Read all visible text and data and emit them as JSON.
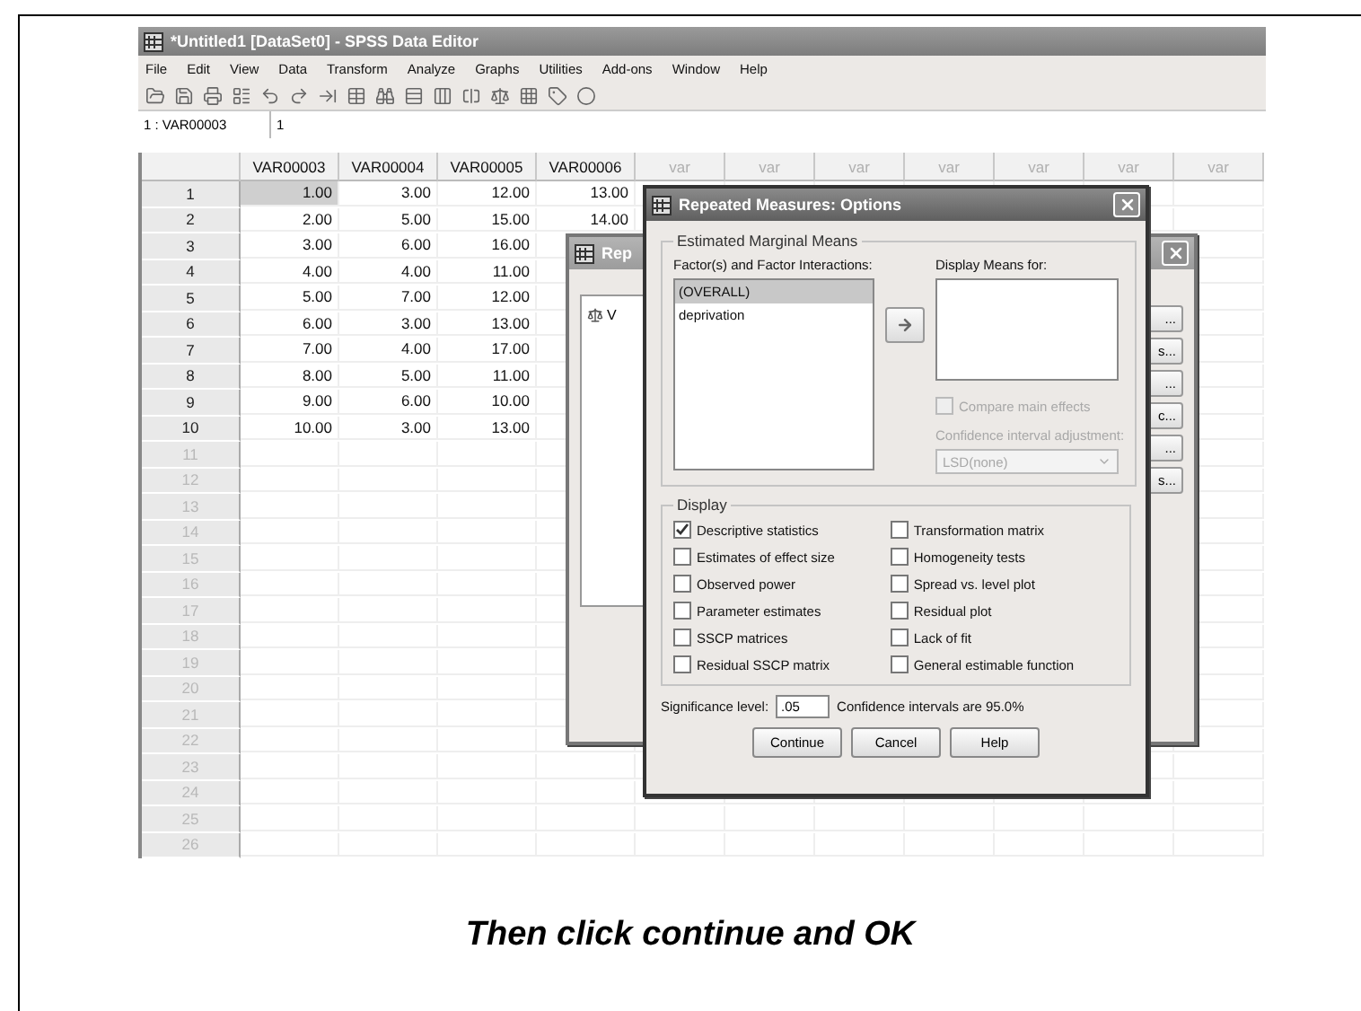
{
  "window": {
    "title": "*Untitled1 [DataSet0] - SPSS Data Editor"
  },
  "menu": [
    "File",
    "Edit",
    "View",
    "Data",
    "Transform",
    "Analyze",
    "Graphs",
    "Utilities",
    "Add-ons",
    "Window",
    "Help"
  ],
  "cell_editor": {
    "reference": "1 : VAR00003",
    "value": "1"
  },
  "table": {
    "columns": [
      {
        "label": "VAR00003",
        "kind": "variable"
      },
      {
        "label": "VAR00004",
        "kind": "variable"
      },
      {
        "label": "VAR00005",
        "kind": "variable"
      },
      {
        "label": "VAR00006",
        "kind": "variable"
      },
      {
        "label": "var",
        "kind": "empty"
      },
      {
        "label": "var",
        "kind": "empty"
      },
      {
        "label": "var",
        "kind": "empty"
      },
      {
        "label": "var",
        "kind": "empty"
      },
      {
        "label": "var",
        "kind": "empty"
      },
      {
        "label": "var",
        "kind": "empty"
      },
      {
        "label": "var",
        "kind": "empty"
      }
    ],
    "rows": [
      {
        "label": "1",
        "has_data": true,
        "cells": [
          {
            "text": "1.00",
            "selected": true
          },
          {
            "text": "3.00",
            "selected": false
          },
          {
            "text": "12.00",
            "selected": false
          },
          {
            "text": "13.00",
            "selected": false
          }
        ]
      },
      {
        "label": "2",
        "has_data": true,
        "cells": [
          {
            "text": "2.00",
            "selected": false
          },
          {
            "text": "5.00",
            "selected": false
          },
          {
            "text": "15.00",
            "selected": false
          },
          {
            "text": "14.00",
            "selected": false
          }
        ]
      },
      {
        "label": "3",
        "has_data": true,
        "cells": [
          {
            "text": "3.00",
            "selected": false
          },
          {
            "text": "6.00",
            "selected": false
          },
          {
            "text": "16.00",
            "selected": false
          }
        ]
      },
      {
        "label": "4",
        "has_data": true,
        "cells": [
          {
            "text": "4.00",
            "selected": false
          },
          {
            "text": "4.00",
            "selected": false
          },
          {
            "text": "11.00",
            "selected": false
          }
        ]
      },
      {
        "label": "5",
        "has_data": true,
        "cells": [
          {
            "text": "5.00",
            "selected": false
          },
          {
            "text": "7.00",
            "selected": false
          },
          {
            "text": "12.00",
            "selected": false
          }
        ]
      },
      {
        "label": "6",
        "has_data": true,
        "cells": [
          {
            "text": "6.00",
            "selected": false
          },
          {
            "text": "3.00",
            "selected": false
          },
          {
            "text": "13.00",
            "selected": false
          }
        ]
      },
      {
        "label": "7",
        "has_data": true,
        "cells": [
          {
            "text": "7.00",
            "selected": false
          },
          {
            "text": "4.00",
            "selected": false
          },
          {
            "text": "17.00",
            "selected": false
          }
        ]
      },
      {
        "label": "8",
        "has_data": true,
        "cells": [
          {
            "text": "8.00",
            "selected": false
          },
          {
            "text": "5.00",
            "selected": false
          },
          {
            "text": "11.00",
            "selected": false
          }
        ]
      },
      {
        "label": "9",
        "has_data": true,
        "cells": [
          {
            "text": "9.00",
            "selected": false
          },
          {
            "text": "6.00",
            "selected": false
          },
          {
            "text": "10.00",
            "selected": false
          }
        ]
      },
      {
        "label": "10",
        "has_data": true,
        "cells": [
          {
            "text": "10.00",
            "selected": false
          },
          {
            "text": "3.00",
            "selected": false
          },
          {
            "text": "13.00",
            "selected": false
          }
        ]
      },
      {
        "label": "11",
        "has_data": false
      },
      {
        "label": "12",
        "has_data": false
      },
      {
        "label": "13",
        "has_data": false
      },
      {
        "label": "14",
        "has_data": false
      },
      {
        "label": "15",
        "has_data": false
      },
      {
        "label": "16",
        "has_data": false
      },
      {
        "label": "17",
        "has_data": false
      },
      {
        "label": "18",
        "has_data": false
      },
      {
        "label": "19",
        "has_data": false
      },
      {
        "label": "20",
        "has_data": false
      },
      {
        "label": "21",
        "has_data": false
      },
      {
        "label": "22",
        "has_data": false
      },
      {
        "label": "23",
        "has_data": false
      },
      {
        "label": "24",
        "has_data": false
      },
      {
        "label": "25",
        "has_data": false
      },
      {
        "label": "26",
        "has_data": false
      }
    ]
  },
  "back_dialog": {
    "title": "Rep",
    "variable": "V",
    "buttons": [
      "...",
      "s...",
      "...",
      "c...",
      "...",
      "s..."
    ]
  },
  "options_dialog": {
    "title": "Repeated Measures: Options",
    "marginal_means": {
      "title": "Estimated Marginal Means",
      "factors_label": "Factor(s) and Factor Interactions:",
      "factors": [
        {
          "label": "(OVERALL)",
          "selected": true
        },
        {
          "label": "deprivation",
          "selected": false
        }
      ],
      "means_label": "Display Means for:",
      "compare": {
        "label": "Compare main effects",
        "checked": false,
        "disabled": true
      },
      "adjustment_label": "Confidence interval adjustment:",
      "adjustment": {
        "value": "LSD(none)",
        "disabled": true
      }
    },
    "display": {
      "title": "Display",
      "options": [
        {
          "label": "Descriptive statistics",
          "checked": true
        },
        {
          "label": "Transformation matrix",
          "checked": false
        },
        {
          "label": "Estimates of effect size",
          "checked": false
        },
        {
          "label": "Homogeneity tests",
          "checked": false
        },
        {
          "label": "Observed power",
          "checked": false
        },
        {
          "label": "Spread vs. level plot",
          "checked": false
        },
        {
          "label": "Parameter estimates",
          "checked": false
        },
        {
          "label": "Residual plot",
          "checked": false
        },
        {
          "label": "SSCP matrices",
          "checked": false
        },
        {
          "label": "Lack of fit",
          "checked": false
        },
        {
          "label": "Residual SSCP matrix",
          "checked": false
        },
        {
          "label": "General estimable function",
          "checked": false
        }
      ]
    },
    "significance": {
      "label": "Significance level:",
      "value": ".05",
      "note": "Confidence intervals are 95.0%"
    },
    "buttons": [
      "Continue",
      "Cancel",
      "Help"
    ]
  },
  "caption": "Then click continue and OK"
}
